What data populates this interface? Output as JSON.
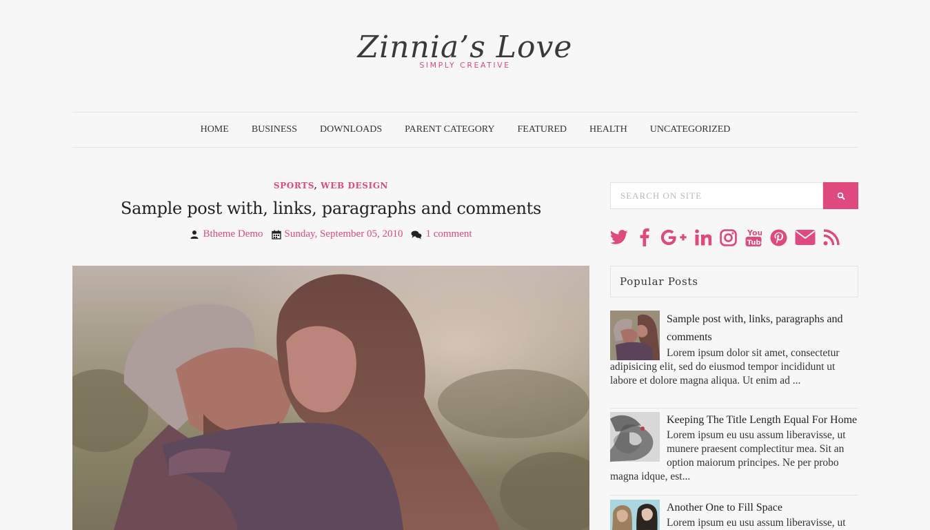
{
  "site": {
    "title": "Zinnia’s Love",
    "tagline": "SIMPLY CREATIVE",
    "accent_color": "#e0497e"
  },
  "nav": {
    "items": [
      {
        "label": "HOME"
      },
      {
        "label": "BUSINESS"
      },
      {
        "label": "DOWNLOADS"
      },
      {
        "label": "PARENT CATEGORY"
      },
      {
        "label": "FEATURED"
      },
      {
        "label": "HEALTH"
      },
      {
        "label": "UNCATEGORIZED"
      }
    ]
  },
  "post": {
    "categories": [
      "SPORTS",
      "WEB DESIGN"
    ],
    "category_separator": ",",
    "title": "Sample post with, links, paragraphs and comments",
    "author": "Btheme Demo",
    "date": "Sunday, September 05, 2010",
    "comments": "1 comment",
    "image_icon": "couple-kissing-photo"
  },
  "sidebar": {
    "search": {
      "placeholder": "SEARCH ON SITE",
      "button_icon": "search-icon"
    },
    "social": [
      "twitter-icon",
      "facebook-icon",
      "google-plus-icon",
      "linkedin-icon",
      "instagram-icon",
      "youtube-icon",
      "pinterest-icon",
      "email-icon",
      "rss-icon"
    ],
    "popular": {
      "title": "Popular Posts",
      "items": [
        {
          "title": "Sample post with, links, paragraphs and comments",
          "excerpt": "Lorem ipsum dolor sit amet, consectetur adipisicing elit, sed do eiusmod tempor incididunt ut labore et dolore magna aliqua. Ut enim ad ..."
        },
        {
          "title": "Keeping The Title Length Equal For Home",
          "excerpt": "Lorem ipsum eu usu assum liberavisse, ut munere praesent complectitur mea. Sit an option maiorum principes. Ne per probo magna idque, est..."
        },
        {
          "title": "Another One to Fill Space",
          "excerpt": "Lorem ipsum eu usu assum liberavisse, ut"
        }
      ]
    }
  }
}
